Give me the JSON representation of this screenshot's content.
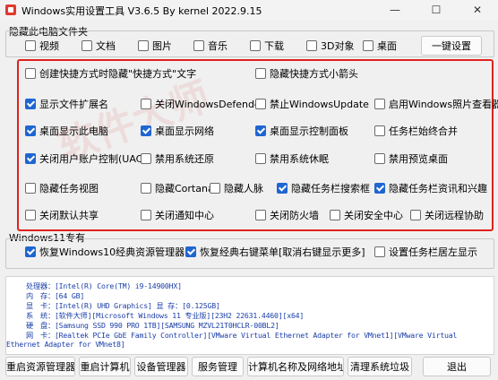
{
  "window": {
    "title": "Windows实用设置工具 V3.6.5 By kernel 2022.9.15",
    "min": "—",
    "max": "☐",
    "close": "✕"
  },
  "hide_group": {
    "label": "隐藏此电脑文件夹",
    "items": [
      {
        "label": "视频",
        "checked": false
      },
      {
        "label": "文档",
        "checked": false
      },
      {
        "label": "图片",
        "checked": false
      },
      {
        "label": "音乐",
        "checked": false
      },
      {
        "label": "下载",
        "checked": false
      },
      {
        "label": "3D对象",
        "checked": false
      },
      {
        "label": "桌面",
        "checked": false
      }
    ],
    "one_key": "一键设置"
  },
  "options": [
    {
      "label": "创建快捷方式时隐藏\"快捷方式\"文字",
      "checked": false
    },
    {
      "label": "隐藏快捷方式小箭头",
      "checked": false
    },
    {
      "label": "显示文件扩展名",
      "checked": true
    },
    {
      "label": "关闭WindowsDefender",
      "checked": false
    },
    {
      "label": "禁止WindowsUpdate",
      "checked": false
    },
    {
      "label": "启用Windows照片查看器",
      "checked": false
    },
    {
      "label": "桌面显示此电脑",
      "checked": true
    },
    {
      "label": "桌面显示网络",
      "checked": true
    },
    {
      "label": "桌面显示控制面板",
      "checked": true
    },
    {
      "label": "任务栏始终合并",
      "checked": false
    },
    {
      "label": "关闭用户账户控制(UAC)",
      "checked": true
    },
    {
      "label": "禁用系统还原",
      "checked": false
    },
    {
      "label": "禁用系统休眠",
      "checked": false
    },
    {
      "label": "禁用预览桌面",
      "checked": false
    },
    {
      "label": "隐藏任务视图",
      "checked": false
    },
    {
      "label": "隐藏Cortana",
      "checked": false
    },
    {
      "label": "隐藏人脉",
      "checked": false
    },
    {
      "label": "隐藏任务栏搜索框",
      "checked": true
    },
    {
      "label": "隐藏任务栏资讯和兴趣",
      "checked": true
    },
    {
      "label": "关闭默认共享",
      "checked": false
    },
    {
      "label": "关闭通知中心",
      "checked": false
    },
    {
      "label": "关闭防火墙",
      "checked": false
    },
    {
      "label": "关闭安全中心",
      "checked": false
    },
    {
      "label": "关闭远程协助",
      "checked": false
    }
  ],
  "win11_group": {
    "label": "Windows11专有",
    "items": [
      {
        "label": "恢复Windows10经典资源管理器",
        "checked": true
      },
      {
        "label": "恢复经典右键菜单[取消右键显示更多]",
        "checked": true
      },
      {
        "label": "设置任务栏居左显示",
        "checked": false
      }
    ]
  },
  "sysinfo": [
    "处理器：[Intel(R) Core(TM) i9-14900HX]",
    "内　存：[64 GB]",
    "显　卡：[Intel(R) UHD Graphics]  显 存：[0.125GB]",
    "系　统：[软件大师][Microsoft Windows 11 专业版][23H2 22631.4460][x64]",
    "硬　盘：[Samsung SSD 990 PRO 1TB][SAMSUNG MZVL21T0HCLR-00BL2]",
    "网　卡：[Realtek PCIe GbE Family Controller][VMware Virtual Ethernet Adapter for VMnet1][VMware Virtual",
    "Ethernet Adapter for VMnet8]"
  ],
  "buttons": [
    "重启资源管理器",
    "重启计算机",
    "设备管理器",
    "服务管理",
    "计算机名称及网络地址",
    "清理系统垃圾",
    "退出"
  ],
  "colors": {
    "accent": "#1f66d1",
    "highlight_frame": "#e0211d",
    "info_text": "#1a3ea8"
  }
}
